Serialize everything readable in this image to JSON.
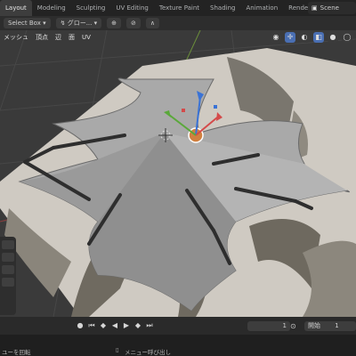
{
  "workspace_tabs": [
    "Layout",
    "Modeling",
    "Sculpting",
    "UV Editing",
    "Texture Paint",
    "Shading",
    "Animation",
    "Rendering"
  ],
  "scene_label": "Scene",
  "toolbar": {
    "select_box": "Select Box",
    "transform_orientation": "グロー...",
    "icons": [
      "cursor-icon",
      "snap-icon",
      "proportional-icon"
    ]
  },
  "menubar": [
    "メッシュ",
    "頂点",
    "辺",
    "面",
    "UV"
  ],
  "timeline": {
    "current_frame": "1",
    "start_label": "開始",
    "start_value": "1"
  },
  "statusbar": {
    "left": "ユーを回転",
    "center": "メニュー呼び出し"
  },
  "colors": {
    "accent": "#4a6fb3",
    "mesh_face": "#a9a9a9",
    "background": "#3a3a3a"
  }
}
